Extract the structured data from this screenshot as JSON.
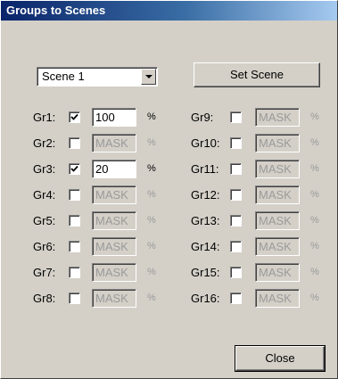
{
  "window": {
    "title": "Groups to Scenes"
  },
  "scene_select": {
    "value": "Scene 1"
  },
  "buttons": {
    "set_scene": "Set Scene",
    "close": "Close"
  },
  "groups": [
    {
      "label": "Gr1:",
      "checked": true,
      "value": "100",
      "unit": "%"
    },
    {
      "label": "Gr2:",
      "checked": false,
      "value": "MASK",
      "unit": "%"
    },
    {
      "label": "Gr3:",
      "checked": true,
      "value": "20",
      "unit": "%"
    },
    {
      "label": "Gr4:",
      "checked": false,
      "value": "MASK",
      "unit": "%"
    },
    {
      "label": "Gr5:",
      "checked": false,
      "value": "MASK",
      "unit": "%"
    },
    {
      "label": "Gr6:",
      "checked": false,
      "value": "MASK",
      "unit": "%"
    },
    {
      "label": "Gr7:",
      "checked": false,
      "value": "MASK",
      "unit": "%"
    },
    {
      "label": "Gr8:",
      "checked": false,
      "value": "MASK",
      "unit": "%"
    },
    {
      "label": "Gr9:",
      "checked": false,
      "value": "MASK",
      "unit": "%"
    },
    {
      "label": "Gr10:",
      "checked": false,
      "value": "MASK",
      "unit": "%"
    },
    {
      "label": "Gr11:",
      "checked": false,
      "value": "MASK",
      "unit": "%"
    },
    {
      "label": "Gr12:",
      "checked": false,
      "value": "MASK",
      "unit": "%"
    },
    {
      "label": "Gr13:",
      "checked": false,
      "value": "MASK",
      "unit": "%"
    },
    {
      "label": "Gr14:",
      "checked": false,
      "value": "MASK",
      "unit": "%"
    },
    {
      "label": "Gr15:",
      "checked": false,
      "value": "MASK",
      "unit": "%"
    },
    {
      "label": "Gr16:",
      "checked": false,
      "value": "MASK",
      "unit": "%"
    }
  ]
}
